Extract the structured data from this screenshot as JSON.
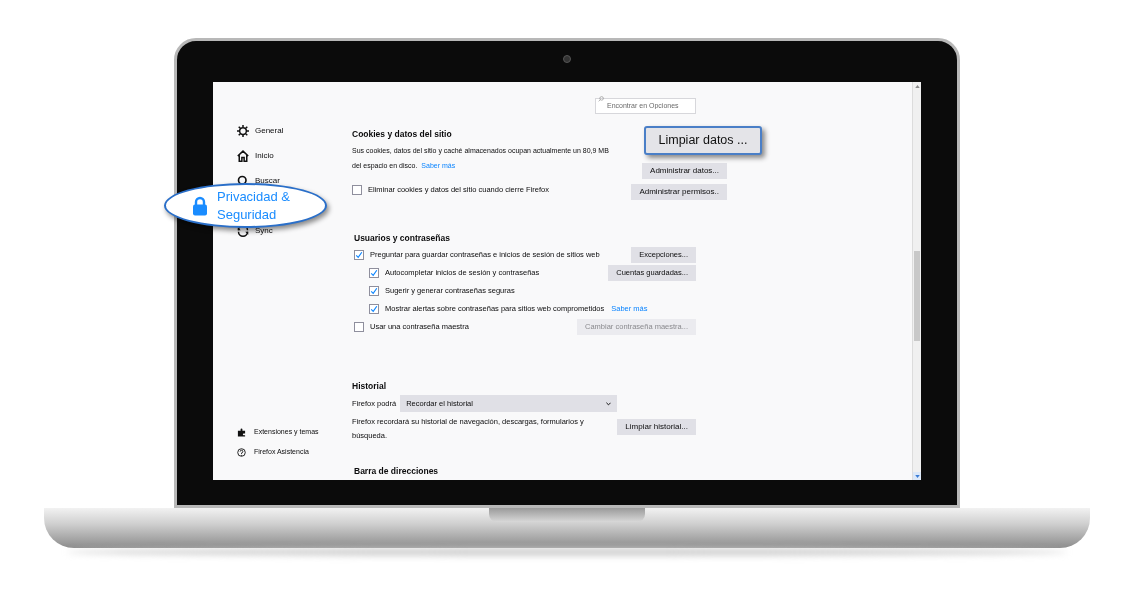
{
  "search": {
    "placeholder": "Encontrar en Opciones"
  },
  "sidebar": {
    "items": [
      {
        "label": "General",
        "selected": false
      },
      {
        "label": "Inicio",
        "selected": false
      },
      {
        "label": "Buscar",
        "selected": false
      },
      {
        "label": "Privacidad & Seguridad",
        "selected": true
      },
      {
        "label": "Sync",
        "selected": false
      }
    ],
    "footer": [
      {
        "label": "Extensiones y temas"
      },
      {
        "label": "Firefox Asistencia"
      }
    ]
  },
  "cookies": {
    "heading": "Cookies y datos del sitio",
    "description": "Sus cookies, datos del sitio y caché almacenados ocupan actualmente un 80,9 MB del espacio en disco.",
    "link": "Saber más",
    "checkbox": {
      "label": "Eliminar cookies y datos del sitio cuando cierre Firefox",
      "checked": false
    },
    "buttons": [
      {
        "label": "Limpiar datos ...",
        "highlighted": true
      },
      {
        "label": "Administrar datos...",
        "highlighted": false
      },
      {
        "label": "Administrar permisos..",
        "highlighted": false
      }
    ]
  },
  "passwords": {
    "heading": "Usuarios y contraseñas",
    "checkboxes": [
      {
        "label": "Preguntar para guardar contraseñas e inicios de sesión de sitios web",
        "checked": true,
        "children": [
          {
            "label": "Autocompletar inicios de sesión y contraseñas",
            "checked": true
          },
          {
            "label": "Sugerir y generar contraseñas seguras",
            "checked": true
          },
          {
            "label": "Mostrar alertas sobre contraseñas para sitios web comprometidos",
            "checked": true,
            "link": "Saber más"
          }
        ]
      },
      {
        "label": "Usar una contraseña maestra",
        "checked": false
      }
    ],
    "buttons": [
      {
        "label": "Excepciones...",
        "disabled": false
      },
      {
        "label": "Cuentas guardadas...",
        "disabled": false
      },
      {
        "label": "Cambiar contraseña maestra...",
        "disabled": true
      }
    ]
  },
  "history": {
    "heading": "Historial",
    "select_label": "Firefox podrá",
    "select_value": "Recordar el historial",
    "description": "Firefox recordará su historial de navegación, descargas, formularios y búsqueda.",
    "button": "Limpiar historial..."
  },
  "next_heading": "Barra de direcciones"
}
